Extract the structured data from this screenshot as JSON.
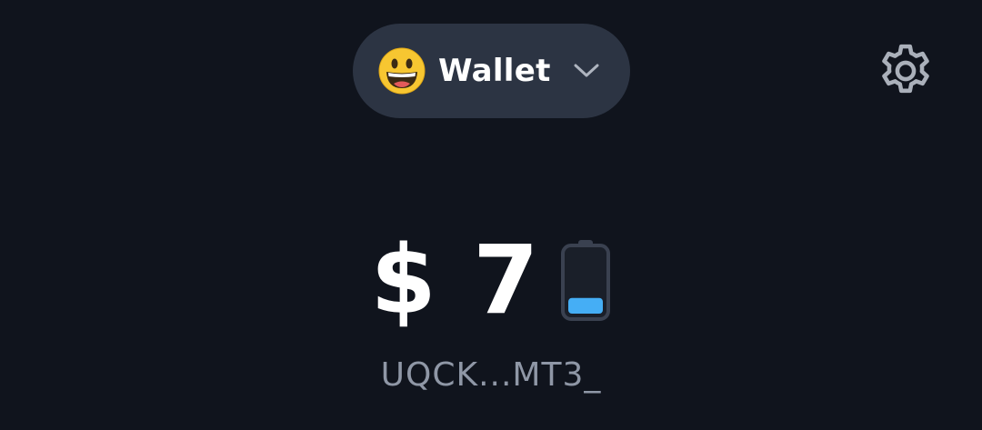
{
  "header": {
    "wallet_emoji": "😀",
    "wallet_name": "Wallet",
    "wallet_dropdown_icon": "chevron-down-icon",
    "settings_icon": "gear-icon"
  },
  "balance": {
    "amount": "$ 7",
    "battery_icon": "battery-icon",
    "battery_level": 0.25
  },
  "address": {
    "short": "UQCK...MT3_"
  },
  "colors": {
    "background": "#10141d",
    "pill": "#2c3443",
    "text_primary": "#ffffff",
    "text_secondary": "#8f97a6",
    "battery_fill": "#45aef5"
  }
}
